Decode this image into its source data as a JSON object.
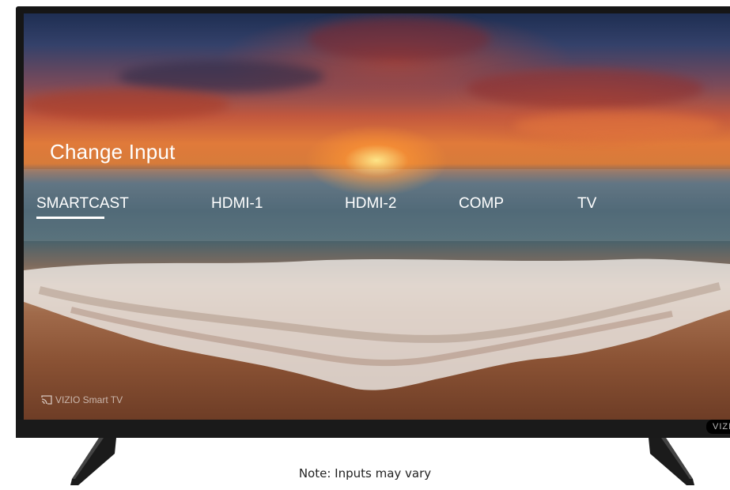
{
  "screen": {
    "title": "Change Input",
    "inputs": [
      {
        "label": "SMARTCAST",
        "selected": true
      },
      {
        "label": "HDMI-1",
        "selected": false
      },
      {
        "label": "HDMI-2",
        "selected": false
      },
      {
        "label": "COMP",
        "selected": false
      },
      {
        "label": "TV",
        "selected": false
      }
    ],
    "watermark": "VIZIO Smart TV"
  },
  "tv": {
    "brand_label": "VIZIO"
  },
  "note": "Note: Inputs may vary",
  "colors": {
    "text": "#ffffff",
    "bezel": "#161616"
  }
}
